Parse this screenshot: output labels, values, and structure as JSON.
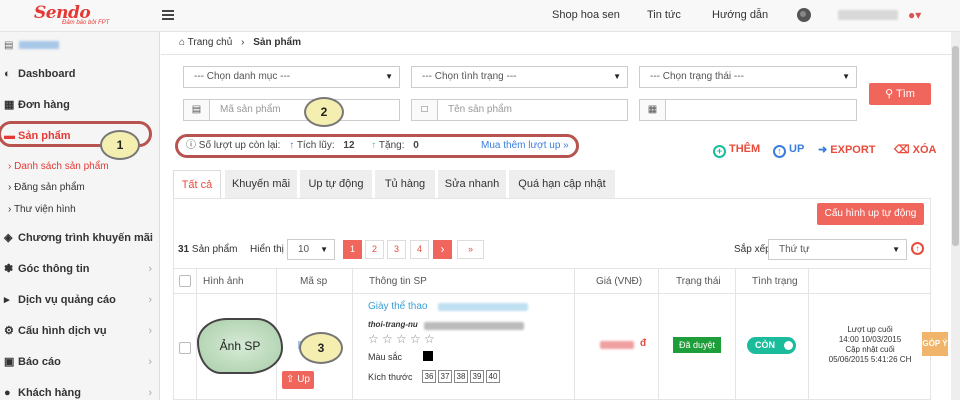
{
  "brand": {
    "logo": "Sendo",
    "tagline": "Đảm bảo bởi FPT"
  },
  "topnav": {
    "shop_link": "Shop hoa sen",
    "news": "Tin tức",
    "guide": "Hướng dẫn"
  },
  "sidebar": {
    "items": [
      {
        "label": "Dashboard",
        "icon": "dashboard-icon"
      },
      {
        "label": "Đơn hàng",
        "icon": "table-icon"
      },
      {
        "label": "Sản phẩm",
        "icon": "folder-icon"
      },
      {
        "label": "Chương trình khuyến mãi",
        "icon": "tag-icon"
      },
      {
        "label": "Góc thông tin",
        "icon": "cog-icon"
      },
      {
        "label": "Dịch vụ quảng cáo",
        "icon": "bullhorn-icon"
      },
      {
        "label": "Cấu hình dịch vụ",
        "icon": "gear-icon"
      },
      {
        "label": "Báo cáo",
        "icon": "report-icon"
      },
      {
        "label": "Khách hàng",
        "icon": "users-icon"
      }
    ],
    "subitems": [
      "Danh sách sản phẩm",
      "Đăng sản phẩm",
      "Thư viện hình"
    ]
  },
  "breadcrumb": {
    "home": "Trang chủ",
    "current": "Sản phẩm"
  },
  "filters": {
    "category": "--- Chọn danh mục ---",
    "condition": "--- Chọn tình trạng ---",
    "status": "--- Chọn trạng thái ---",
    "sku_placeholder": "Mã sản phẩm",
    "name_placeholder": "Tên sản phẩm",
    "search_button": "Tìm"
  },
  "stats": {
    "remaining_label": "Số lượt up còn lại:",
    "accumulated_label": "Tích lũy:",
    "accumulated_value": "12",
    "bonus_label": "Tặng:",
    "bonus_value": "0",
    "buy_more": "Mua thêm lượt up »"
  },
  "actions": {
    "add": "THÊM",
    "up": "UP",
    "export": "EXPORT",
    "delete": "XÓA"
  },
  "tabs": [
    "Tất cả",
    "Khuyến mãi",
    "Up tự động",
    "Tủ hàng",
    "Sửa nhanh",
    "Quá hạn cập nhật"
  ],
  "auto_up_config": "Cấu hình up tự động",
  "list": {
    "count": "31",
    "count_label": "Sản phẩm",
    "display_label": "Hiển thị",
    "page_size": "10",
    "pages": [
      "1",
      "2",
      "3",
      "4"
    ],
    "next": "›",
    "last": "»",
    "sort_label": "Sắp xếp",
    "sort_value": "Thứ tự"
  },
  "table": {
    "headers": [
      "Hình ảnh",
      "Mã sp",
      "Thông tin SP",
      "Giá (VNĐ)",
      "Trạng thái",
      "Tình trạng"
    ],
    "row": {
      "name_prefix": "Giày thể thao",
      "slug_prefix": "thoi-trang-nu",
      "color_label": "Màu sắc",
      "size_label": "Kích thước",
      "sizes": [
        "36",
        "37",
        "38",
        "39",
        "40"
      ],
      "price_suffix": "đ",
      "status": "Đã duyệt",
      "condition": "CÒN",
      "up_button": "Up",
      "last_up_label": "Lượt up cuối",
      "last_up_time": "14:00 10/03/2015",
      "last_update_label": "Cập nhật cuối",
      "last_update_time": "05/06/2015 5:41:26 CH"
    }
  },
  "annotations": {
    "n1": "1",
    "n2": "2",
    "n3": "3",
    "image_label": "Ảnh SP"
  },
  "feedback_tab": "GÓP Ý",
  "colors": {
    "brand": "#e53935",
    "accent": "#f0665c",
    "green": "#1e9e3a",
    "teal": "#1abc9c",
    "link": "#3b7ddd",
    "annotation": "#b85450"
  }
}
